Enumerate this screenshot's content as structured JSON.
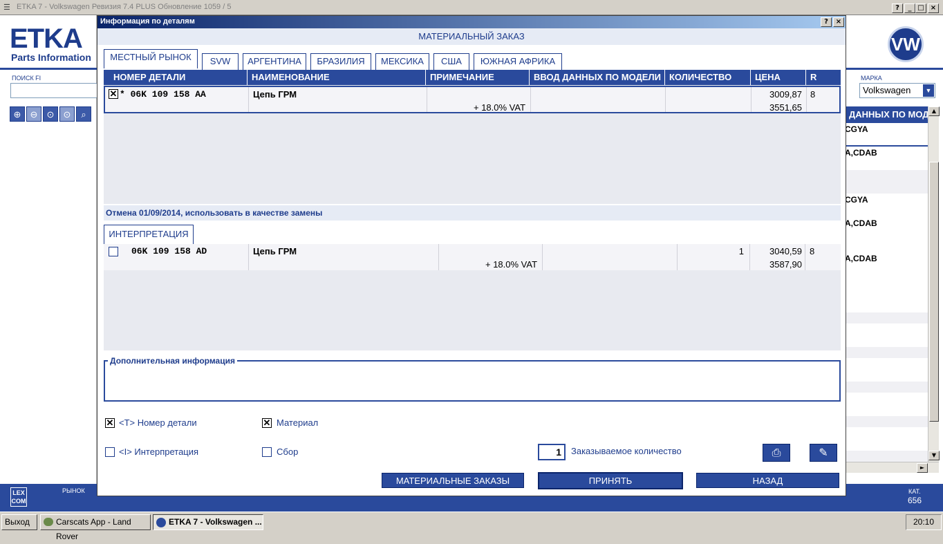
{
  "window": {
    "title": "ETKA 7 - Volkswagen Ревизия 7.4 PLUS Обновление 1059 / 5",
    "controls": [
      "?",
      "_",
      "□",
      "×"
    ]
  },
  "background_app": {
    "logo_text": "ETKA",
    "logo_sub": "Parts Information",
    "search_label": "ПОИСК FI",
    "brand_label": "МАРКА",
    "brand_value": "Volkswagen",
    "right_header": "ДАННЫХ ПО МОД",
    "right_rows": [
      "CGYA",
      "A,CDAB",
      "CGYA",
      "A,CDAB",
      "A,CDAB"
    ],
    "market_label": "РЫНОК",
    "cat_label": "КАТ.",
    "cat_value": "656",
    "lex_label": "LEX COM"
  },
  "dialog": {
    "title": "Информация по деталям",
    "controls": [
      "?",
      "×"
    ],
    "subtitle": "МАТЕРИАЛЬНЫЙ ЗАКАЗ",
    "tabs": [
      {
        "label": "МЕСТНЫЙ РЫНОК",
        "active": true
      },
      {
        "label": "SVW",
        "active": false
      },
      {
        "label": "АРГЕНТИНА",
        "active": false
      },
      {
        "label": "БРАЗИЛИЯ",
        "active": false
      },
      {
        "label": "МЕКСИКА",
        "active": false
      },
      {
        "label": "США",
        "active": false
      },
      {
        "label": "ЮЖНАЯ АФРИКА",
        "active": false
      }
    ],
    "columns": [
      "НОМЕР ДЕТАЛИ",
      "НАИМЕНОВАНИЕ",
      "ПРИМЕЧАНИЕ",
      "ВВОД ДАННЫХ ПО МОДЕЛИ",
      "КОЛИЧЕСТВО",
      "ЦЕНА",
      "R"
    ],
    "main_row": {
      "checked": true,
      "part_number": "* 06K 109 158 AA",
      "name": "Цепь ГРМ",
      "note": "+ 18.0% VAT",
      "model": "",
      "quantity": "",
      "price": "3009,87",
      "price_vat": "3551,65",
      "r": "8"
    },
    "cancel_note": "Отмена 01/09/2014, использовать в качестве замены",
    "interpretation_tab": "ИНТЕРПРЕТАЦИЯ",
    "replacement_row": {
      "checked": false,
      "part_number": "06K 109 158 AD",
      "name": "Цепь ГРМ",
      "note": "+ 18.0% VAT",
      "model": "",
      "quantity": "1",
      "price": "3040,59",
      "price_vat": "3587,90",
      "r": "8"
    },
    "additional_info_label": "Дополнительная информация",
    "options": {
      "part_number": {
        "label": "<T> Номер детали",
        "checked": true
      },
      "material": {
        "label": "Материал",
        "checked": true
      },
      "interpretation": {
        "label": "<I> Интерпретация",
        "checked": false
      },
      "assembly": {
        "label": "Сбор",
        "checked": false
      }
    },
    "order_quantity_value": "1",
    "order_quantity_label": "Заказываемое количество",
    "buttons": {
      "material_orders": "МАТЕРИАЛЬНЫЕ ЗАКАЗЫ",
      "accept": "ПРИНЯТЬ",
      "back": "НАЗАД"
    }
  },
  "taskbar": {
    "exit": "Выход",
    "items": [
      "Carscats App - Land Rover",
      "ETKA 7 - Volkswagen ..."
    ],
    "clock": "20:10"
  }
}
